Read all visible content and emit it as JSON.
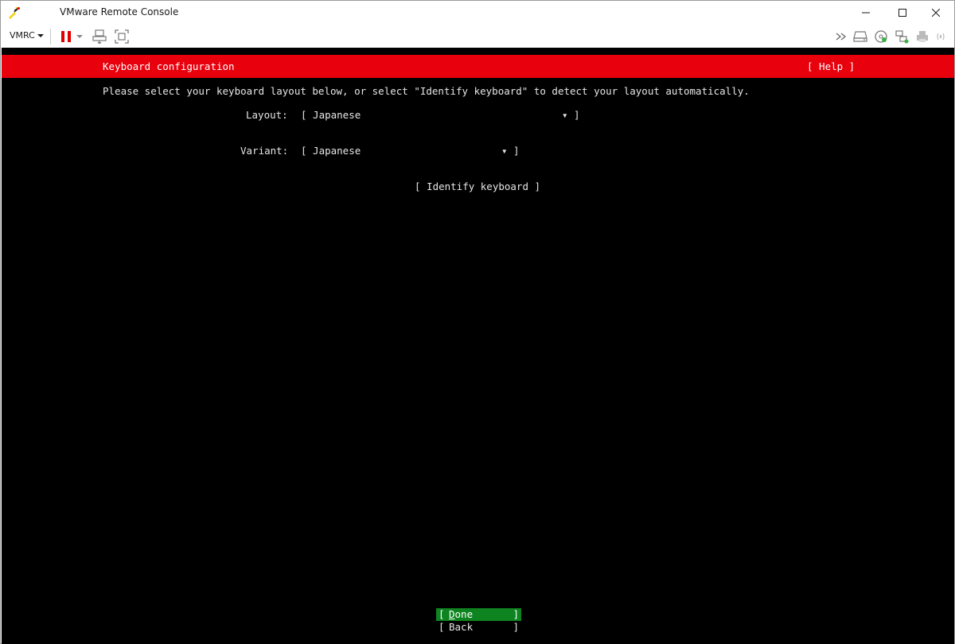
{
  "window": {
    "title": "VMware Remote Console"
  },
  "toolbar": {
    "menu_label": "VMRC",
    "icons": [
      "pause-icon",
      "dropdown-arrow-icon",
      "send-ctrl-alt-del-icon",
      "fullscreen-icon",
      "expand-icon",
      "removable-devices-icon",
      "cd-dvd-icon",
      "network-adapter-icon",
      "printer-icon",
      "sound-icon"
    ]
  },
  "console": {
    "header_title": "Keyboard configuration",
    "help_label": "[ Help ]",
    "instruction": "Please select your keyboard layout below, or select \"Identify keyboard\" to detect your layout automatically.",
    "layout_label": "Layout:",
    "layout_value": "[ Japanese",
    "layout_arrow": "▾ ]",
    "variant_label": "Variant:",
    "variant_value": "[ Japanese",
    "variant_arrow": "▾ ]",
    "identify_button": "[ Identify keyboard ]",
    "done_first": "D",
    "done_rest": "one",
    "back_label": "Back",
    "bracket_open": "[",
    "bracket_close": "]"
  },
  "colors": {
    "header": "#e8000d",
    "done_bg": "#0e8420",
    "console_bg": "#000000"
  }
}
